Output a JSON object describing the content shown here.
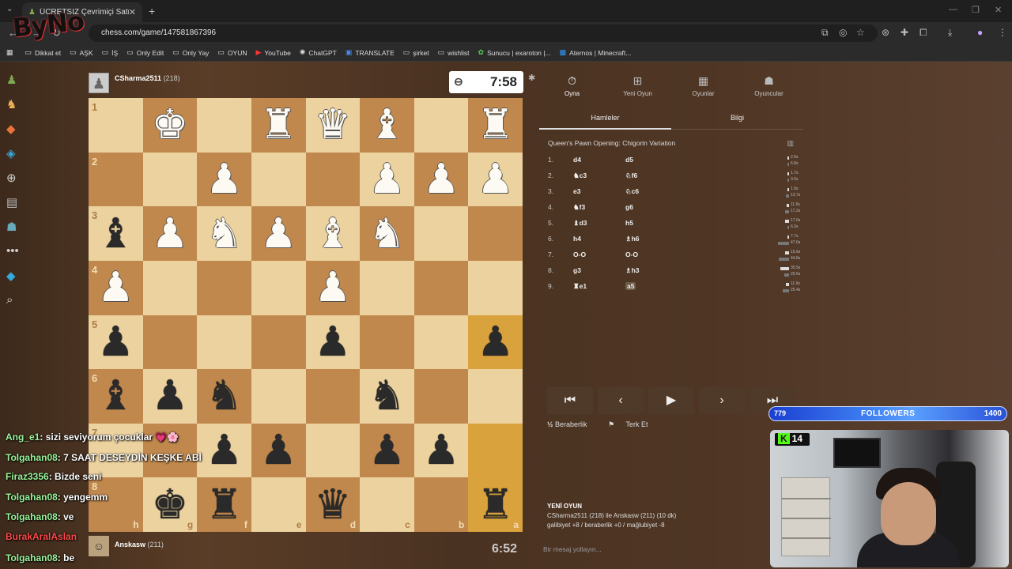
{
  "browser": {
    "tab_title": "ÜCRETSİZ Çevrimiçi Satranç Oyna",
    "url": "chess.com/game/147581867396",
    "bookmarks": [
      "Dikkat et",
      "AŞK",
      "İŞ",
      "Only Edit",
      "Only Yay",
      "OYUN",
      "YouTube",
      "ChatGPT",
      "TRANSLATE",
      "şirket",
      "wishlist",
      "Sunucu | exaroton |...",
      "Aternos | Minecraft..."
    ]
  },
  "watermark": "ByNo",
  "top_player": {
    "name": "CSharma2511",
    "rating": "(218)",
    "clock": "7:58"
  },
  "bottom_player": {
    "name": "Anskasw",
    "rating": "(211)",
    "clock": "6:52"
  },
  "board": {
    "ranks": [
      "1",
      "2",
      "3",
      "4",
      "5",
      "6",
      "7",
      "8"
    ],
    "files": [
      "h",
      "g",
      "f",
      "e",
      "d",
      "c",
      "b",
      "a"
    ],
    "pieces": [
      [
        "",
        "wK",
        "",
        "wR",
        "wQ",
        "wB",
        "",
        "wR"
      ],
      [
        "",
        "",
        "wP",
        "",
        "",
        "wP",
        "wP",
        "wP"
      ],
      [
        "bB",
        "wP",
        "wN",
        "wP",
        "wB",
        "wN",
        "",
        ""
      ],
      [
        "wP",
        "",
        "",
        "",
        "wP",
        "",
        "",
        ""
      ],
      [
        "bP",
        "",
        "",
        "",
        "bP",
        "",
        "",
        "bP"
      ],
      [
        "bB",
        "bP",
        "bN",
        "",
        "",
        "bN",
        "",
        ""
      ],
      [
        "",
        "",
        "bP",
        "bP",
        "",
        "bP",
        "bP",
        ""
      ],
      [
        "",
        "bK",
        "bR",
        "",
        "bQ",
        "",
        "",
        "bR"
      ]
    ]
  },
  "panel": {
    "tabs": [
      "Oyna",
      "Yeni Oyun",
      "Oyunlar",
      "Oyuncular"
    ],
    "subtabs": [
      "Hamleler",
      "Bilgi"
    ],
    "opening": "Queen's Pawn Opening: Chigorin Variation",
    "moves": [
      {
        "n": "1.",
        "w": "d4",
        "b": "d5",
        "tw": "2.9s",
        "tb": "6.8s"
      },
      {
        "n": "2.",
        "w": "♞c3",
        "b": "♘f6",
        "tw": "1.7s",
        "tb": "3.0s"
      },
      {
        "n": "3.",
        "w": "e3",
        "b": "♘c6",
        "tw": "1.9s",
        "tb": "13.7s"
      },
      {
        "n": "4.",
        "w": "♞f3",
        "b": "g6",
        "tw": "11.5s",
        "tb": "17.2s"
      },
      {
        "n": "5.",
        "w": "♝d3",
        "b": "h5",
        "tw": "17.0s",
        "tb": "6.3s"
      },
      {
        "n": "6.",
        "w": "h4",
        "b": "♗h6",
        "tw": "7.7s",
        "tb": "47.6s"
      },
      {
        "n": "7.",
        "w": "O-O",
        "b": "O-O",
        "tw": "15.6s",
        "tb": "44.8s"
      },
      {
        "n": "8.",
        "w": "g3",
        "b": "♗h3",
        "tw": "35.5s",
        "tb": "20.6s"
      },
      {
        "n": "9.",
        "w": "♜e1",
        "b": "a5",
        "tw": "11.9s",
        "tb": "25.4s"
      }
    ],
    "draw": "Beraberlik",
    "resign": "Terk Et",
    "game_title": "YENİ OYUN",
    "game_line": "CSharma2511 (218) ile Anskasw (211) (10 dk)",
    "game_stats": "galibiyet +8 / beraberlik +0 / mağlubiyet -8",
    "message_placeholder": "Bir mesaj yollayın..."
  },
  "stream": {
    "followers_current": "779",
    "followers_label": "FOLLOWERS",
    "followers_goal": "1400",
    "viewer_count": "14",
    "chat": [
      {
        "user": "Ang_e1",
        "text": ": sizi seviyorum çocuklar 💗🌸",
        "red": false
      },
      {
        "user": "Tolgahan08",
        "text": ": 7 SAAT DESEYDİN KEŞKE ABİ",
        "red": false
      },
      {
        "user": "Firaz3356",
        "text": ": Bizde seni",
        "red": false
      },
      {
        "user": "Tolgahan08",
        "text": ": yengemm",
        "red": false
      },
      {
        "user": "Tolgahan08",
        "text": ": ve",
        "red": false
      },
      {
        "user": "BurakAralAslan",
        "text": "",
        "red": true
      },
      {
        "user": "Tolgahan08",
        "text": ": be",
        "red": false
      }
    ]
  }
}
